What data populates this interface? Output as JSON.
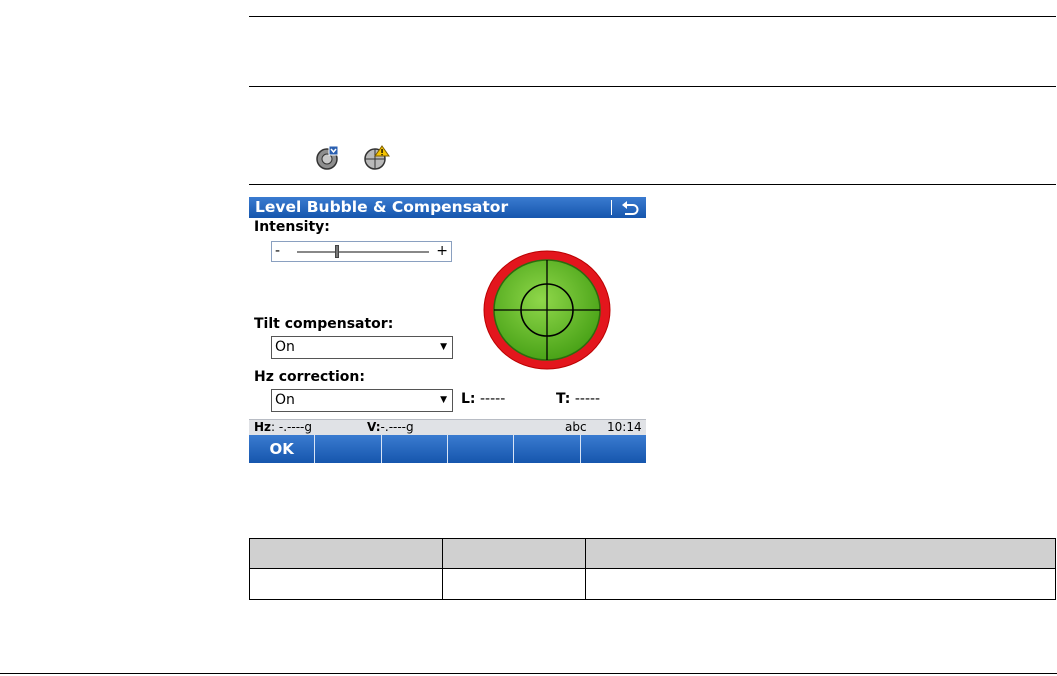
{
  "screen": {
    "title": "Level Bubble & Compensator",
    "icons": {
      "back": "back-arrow-icon",
      "status_icons": [
        "compensator-on-icon",
        "compensator-warning-icon"
      ]
    },
    "intensity": {
      "label": "Intensity:",
      "minus": "-",
      "plus": "+",
      "value_fraction": 0.3
    },
    "tilt_compensator": {
      "label": "Tilt compensator:",
      "value": "On"
    },
    "hz_correction": {
      "label": "Hz correction:",
      "value": "On"
    },
    "readouts": {
      "l_label": "L:",
      "l_value": "-----",
      "t_label": "T:",
      "t_value": "-----"
    },
    "status": {
      "hz_label": "Hz",
      "hz_value": ": -.----g",
      "v_label": "V:",
      "v_value": "-.----g",
      "input_mode": "abc",
      "time": "10:14"
    },
    "softkeys": [
      "OK",
      "",
      "",
      "",
      "",
      ""
    ],
    "colors": {
      "titlebar": "#1f63bd",
      "bubble_green": "#6bc22a",
      "bubble_ring": "#e3161d"
    }
  },
  "table": {
    "headers": [
      "",
      "",
      ""
    ],
    "rows": [
      [
        "",
        "",
        ""
      ]
    ]
  }
}
